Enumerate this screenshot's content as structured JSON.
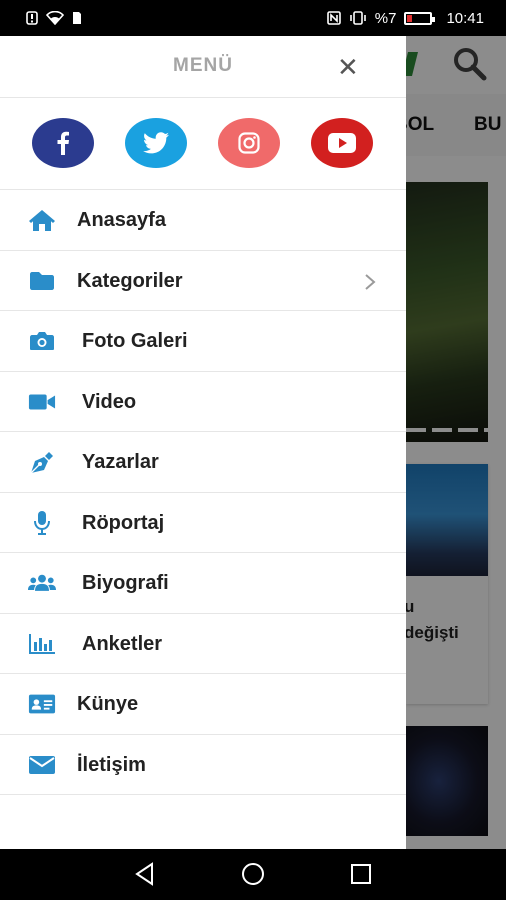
{
  "status_bar": {
    "left_icons": [
      "notification-icon",
      "wifi-icon",
      "sim-icon"
    ],
    "right_text": "%7",
    "time": "10:41",
    "battery_color": "#e03030"
  },
  "app": {
    "tabs": [
      "BOL",
      "BU"
    ],
    "card2_lines": [
      "u",
      "değişti"
    ],
    "accent_color": "#2e8b3a"
  },
  "drawer": {
    "title": "MENÜ",
    "close_icon": "close-icon",
    "socials": [
      {
        "name": "facebook",
        "color": "#2b3b8f"
      },
      {
        "name": "twitter",
        "color": "#1aa1e0"
      },
      {
        "name": "instagram",
        "color": "#f06a6a"
      },
      {
        "name": "youtube",
        "color": "#d2201f"
      }
    ],
    "items": [
      {
        "label": "Anasayfa",
        "icon": "home-icon"
      },
      {
        "label": "Kategoriler",
        "icon": "folder-icon",
        "has_submenu": true
      },
      {
        "label": "Foto Galeri",
        "icon": "camera-icon"
      },
      {
        "label": "Video",
        "icon": "video-icon"
      },
      {
        "label": "Yazarlar",
        "icon": "pen-icon"
      },
      {
        "label": "Röportaj",
        "icon": "microphone-icon"
      },
      {
        "label": "Biyografi",
        "icon": "users-icon"
      },
      {
        "label": "Anketler",
        "icon": "bar-chart-icon"
      },
      {
        "label": "Künye",
        "icon": "id-card-icon"
      },
      {
        "label": "İletişim",
        "icon": "envelope-icon"
      }
    ],
    "icon_color": "#2a8dc9"
  },
  "nav_bar": {
    "buttons": [
      "back-icon",
      "home-icon",
      "recents-icon"
    ]
  }
}
